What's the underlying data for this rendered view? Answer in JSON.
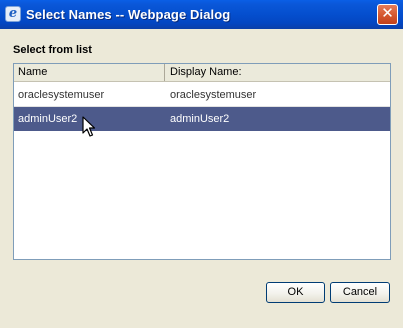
{
  "window": {
    "title": "Select Names -- Webpage Dialog",
    "app_icon": "ie-icon",
    "close_label": "✕"
  },
  "list": {
    "label": "Select from list",
    "columns": [
      "Name",
      "Display Name:"
    ],
    "rows": [
      {
        "name": "oraclesystemuser",
        "display_name": "oraclesystemuser",
        "selected": false
      },
      {
        "name": "adminUser2",
        "display_name": "adminUser2",
        "selected": true
      }
    ]
  },
  "buttons": {
    "ok_label": "OK",
    "cancel_label": "Cancel"
  },
  "colors": {
    "titlebar": "#0550d0",
    "selection": "#4d5a8b",
    "dialog_bg": "#ece9d8"
  }
}
